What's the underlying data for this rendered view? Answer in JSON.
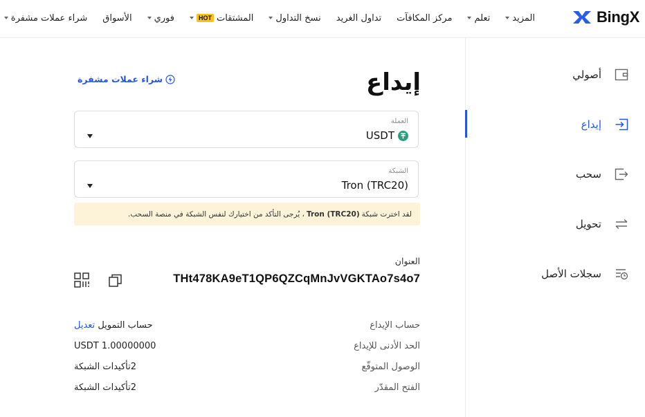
{
  "brand": {
    "name": "BingX",
    "accent": "#2354e6"
  },
  "nav": {
    "items": [
      {
        "label": "شراء عملات مشفرة",
        "caret": true
      },
      {
        "label": "الأسواق",
        "caret": false
      },
      {
        "label": "فوري",
        "caret": true
      },
      {
        "label": "المشتقات",
        "caret": true,
        "badge": "HOT"
      },
      {
        "label": "نسخ التداول",
        "caret": true
      },
      {
        "label": "تداول الغريد",
        "caret": false
      },
      {
        "label": "مركز المكافآت",
        "caret": false
      },
      {
        "label": "تعلم",
        "caret": true
      },
      {
        "label": "المزيد",
        "caret": true
      }
    ]
  },
  "sidebar": {
    "items": [
      {
        "label": "أصولي",
        "icon": "wallet-icon"
      },
      {
        "label": "إيداع",
        "icon": "deposit-icon",
        "active": true
      },
      {
        "label": "سحب",
        "icon": "withdraw-icon"
      },
      {
        "label": "تحويل",
        "icon": "transfer-icon"
      },
      {
        "label": "سجلات الأصل",
        "icon": "records-icon"
      }
    ]
  },
  "main": {
    "title": "إيداع",
    "buy_link": "شراء عملات مشفرة",
    "currency": {
      "label": "العملة",
      "value": "USDT",
      "coin_icon_letter": "₮",
      "coin_color": "#26a17b"
    },
    "network": {
      "label": "الشبكة",
      "value": "Tron (TRC20)"
    },
    "notice": {
      "before": "لقد اخترت شبكة",
      "network": "Tron (TRC20)",
      "after": "، يُرجى التأكد من اختيارك لنفس الشبكة في منصة السحب."
    },
    "address": {
      "label": "العنوان",
      "value": "THt478KA9eT1QP6QZCqMnJvVGKTAo7s4o7"
    },
    "details": [
      {
        "label": "حساب الإيداع",
        "value": "حساب التمويل",
        "link": "تعديل"
      },
      {
        "label": "الحد الأدنى للإيداع",
        "value": "USDT 1.00000000"
      },
      {
        "label": "الوصول المتوقّع",
        "value": "2تأكيدات الشبكة"
      },
      {
        "label": "الفتح المقدّر",
        "value": "2تأكيدات الشبكة"
      }
    ]
  }
}
